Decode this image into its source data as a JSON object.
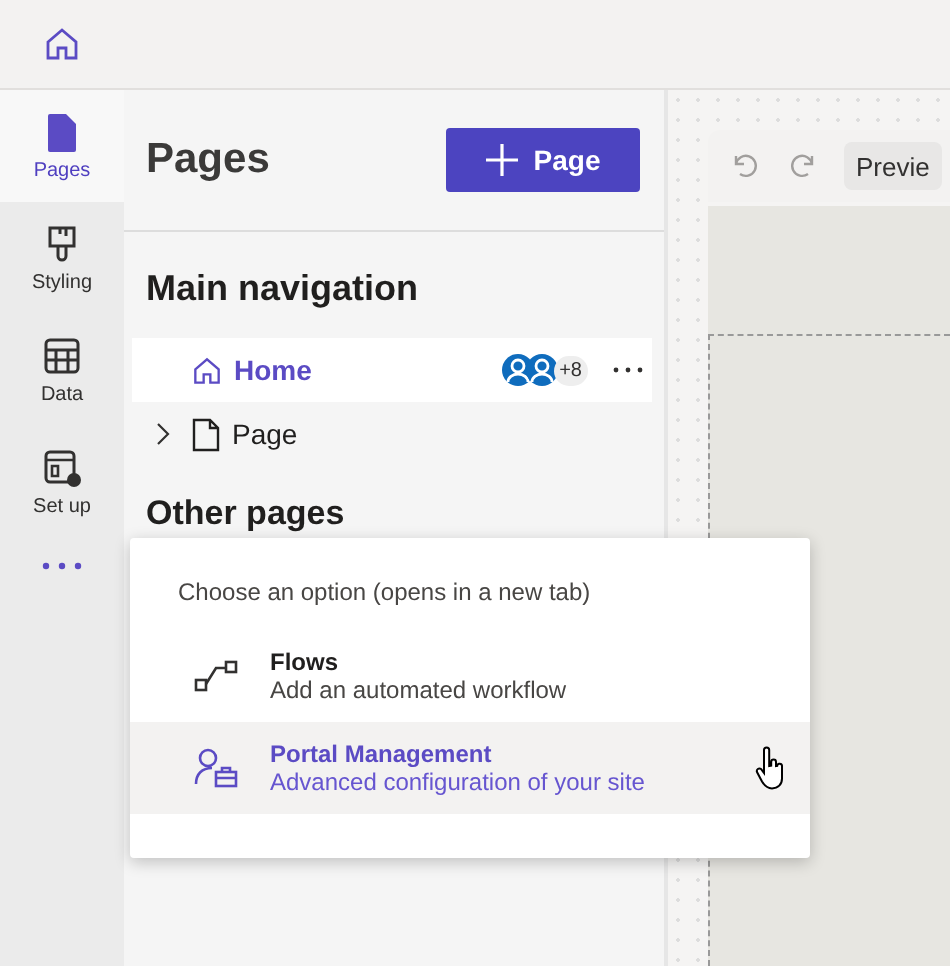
{
  "rail": [
    {
      "kind": "pages",
      "label": "Pages",
      "selected": true
    },
    {
      "kind": "styling",
      "label": "Styling",
      "selected": false
    },
    {
      "kind": "data",
      "label": "Data",
      "selected": false
    },
    {
      "kind": "setup",
      "label": "Set up",
      "selected": false
    }
  ],
  "panel": {
    "title": "Pages",
    "add_button": "Page",
    "main_heading": "Main navigation",
    "items": [
      {
        "kind": "home",
        "label": "Home",
        "selected": true,
        "extra_count": "+8"
      },
      {
        "kind": "page",
        "label": "Page",
        "selected": false,
        "expanded": false
      }
    ],
    "other_heading": "Other pages"
  },
  "popup": {
    "prompt": "Choose an option (opens in a new tab)",
    "options": [
      {
        "kind": "flow",
        "title": "Flows",
        "description": "Add an automated workflow",
        "selected": false
      },
      {
        "kind": "portal",
        "title": "Portal Management",
        "description": "Advanced configuration of your site",
        "selected": true
      }
    ]
  },
  "canvas": {
    "preview_button": "Previe"
  }
}
